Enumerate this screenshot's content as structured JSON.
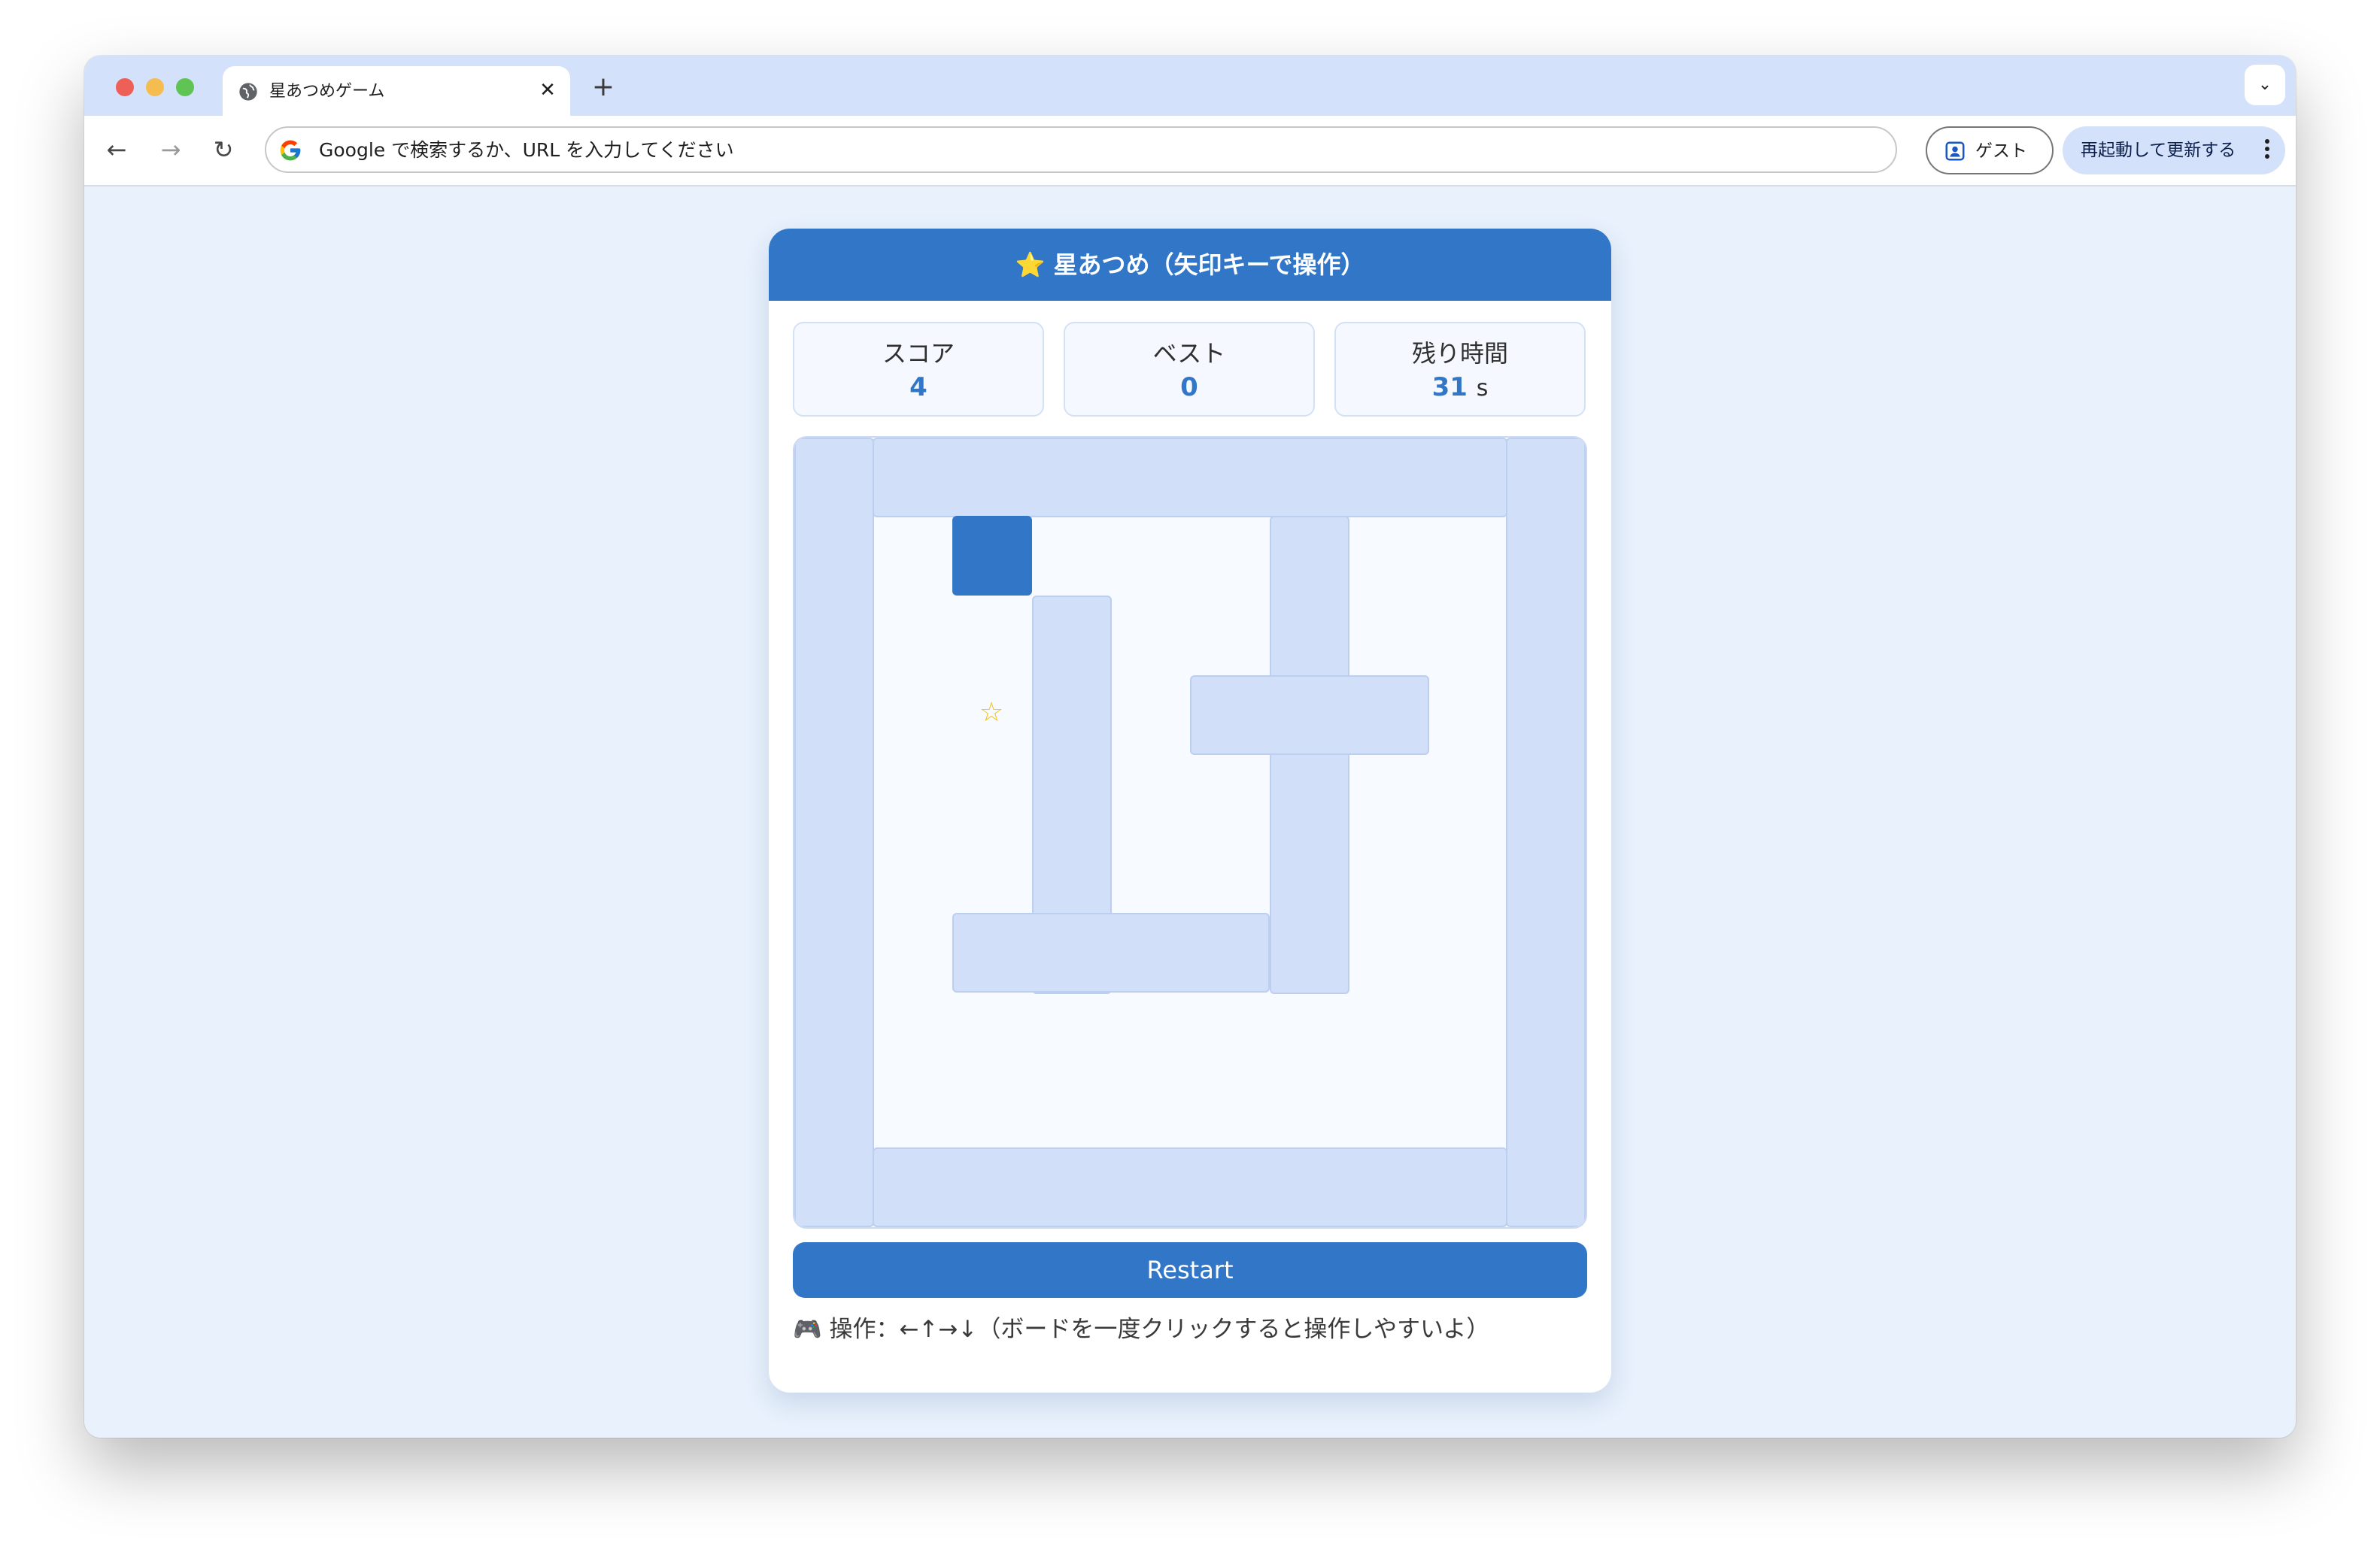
{
  "browser": {
    "tab_title": "星あつめゲーム",
    "new_tab_label": "+",
    "address_placeholder": "Google で検索するか、URL を入力してください",
    "profile_label": "ゲスト",
    "update_label": "再起動して更新する"
  },
  "game": {
    "title": "⭐ 星あつめ（矢印キーで操作）",
    "stats": {
      "score": {
        "label": "スコア",
        "value": "4"
      },
      "best": {
        "label": "ベスト",
        "value": "0"
      },
      "time": {
        "label": "残り時間",
        "value": "31",
        "unit": "s"
      }
    },
    "star_glyph": "☆",
    "restart_label": "Restart",
    "hint": "🎮 操作：←↑→↓（ボードを一度クリックすると操作しやすいよ）"
  },
  "colors": {
    "accent": "#3276c7",
    "wall": "#d1dff8",
    "page_bg": "#e8f1fc"
  }
}
